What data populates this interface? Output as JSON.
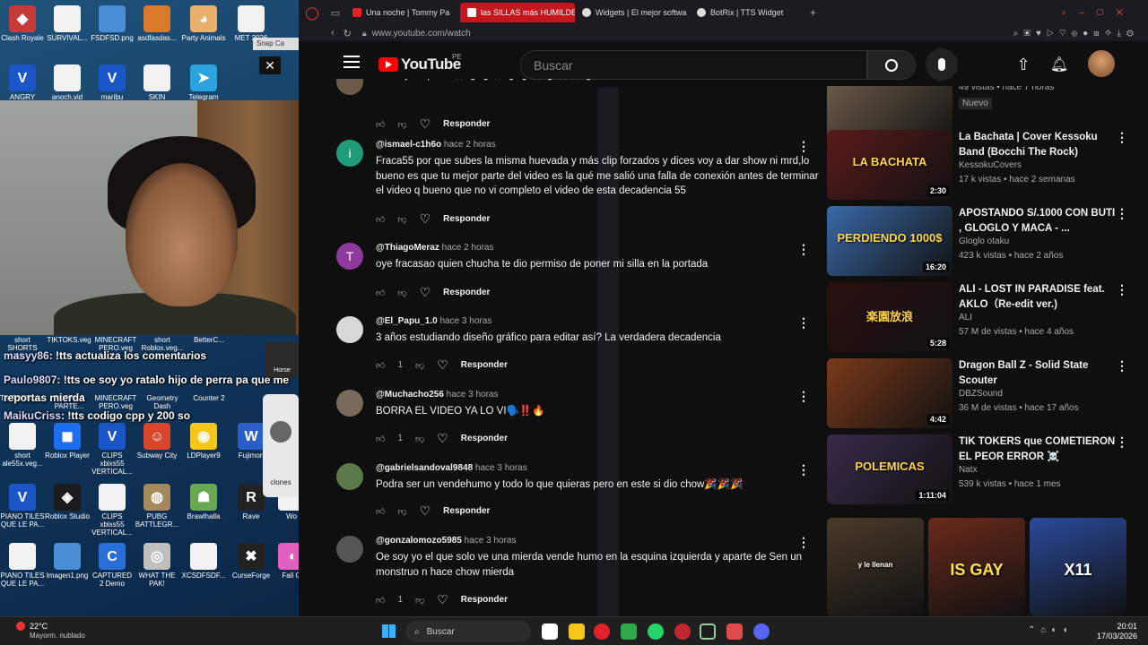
{
  "desktop": {
    "icons": [
      {
        "label": "Clash Royale",
        "color": "#c73a3a",
        "glyph": "◆"
      },
      {
        "label": "SURVIVAL...",
        "color": "#f2f2f2",
        "glyph": ""
      },
      {
        "label": "FSDFSD.png",
        "color": "#4a8fd6",
        "glyph": ""
      },
      {
        "label": "asdfasdas...",
        "color": "#d97a2a",
        "glyph": ""
      },
      {
        "label": "Party Animals",
        "color": "#e8b06a",
        "glyph": "◕"
      },
      {
        "label": "MET 2026",
        "color": "#f2f2f2",
        "glyph": ""
      },
      {
        "label": "ANGRY",
        "color": "#1a56c8",
        "glyph": "V"
      },
      {
        "label": "anoch.vid",
        "color": "#f2f2f2",
        "glyph": ""
      },
      {
        "label": "maribu",
        "color": "#1a56c8",
        "glyph": "V"
      },
      {
        "label": "SKIN",
        "color": "#f2f2f2",
        "glyph": ""
      },
      {
        "label": "Telegram",
        "color": "#2aa3e0",
        "glyph": "➤"
      },
      {
        "label": "short ale55x.veg...",
        "color": "#f2f2f2",
        "glyph": ""
      },
      {
        "label": "Roblox Player",
        "color": "#1e6ff0",
        "glyph": "◼"
      },
      {
        "label": "CLIPS xbixs55 VERTICAL...",
        "color": "#1a56c8",
        "glyph": "V"
      },
      {
        "label": "Subway City",
        "color": "#d9452a",
        "glyph": "☺"
      },
      {
        "label": "LDPlayer9",
        "color": "#f5c518",
        "glyph": "◉"
      },
      {
        "label": "Fujimori",
        "color": "#2a5fc8",
        "glyph": "W"
      },
      {
        "label": "PIANO TILES QUE LE PA...",
        "color": "#1a56c8",
        "glyph": "V"
      },
      {
        "label": "Roblox Studio",
        "color": "#1b1b1b",
        "glyph": "◈"
      },
      {
        "label": "CLIPS xbixs55 VERTICAL...",
        "color": "#f2f2f2",
        "glyph": ""
      },
      {
        "label": "PUBG BATTLEGR...",
        "color": "#a48a5a",
        "glyph": "◍"
      },
      {
        "label": "Brawlhalla",
        "color": "#6aa84f",
        "glyph": "☗"
      },
      {
        "label": "Rave",
        "color": "#222",
        "glyph": "R"
      },
      {
        "label": "Wo",
        "color": "#f2f2f2",
        "glyph": ""
      },
      {
        "label": "PIANO TILES QUE LE PA...",
        "color": "#f2f2f2",
        "glyph": ""
      },
      {
        "label": "Imagen1.png",
        "color": "#4a8fd6",
        "glyph": ""
      },
      {
        "label": "CAPTURED 2 Demo",
        "color": "#2a6fd6",
        "glyph": "C"
      },
      {
        "label": "WHAT THE PAK!",
        "color": "#bfbfbf",
        "glyph": "◎"
      },
      {
        "label": "XCSDFSDF...",
        "color": "#f2f2f2",
        "glyph": ""
      },
      {
        "label": "CurseForge",
        "color": "#222",
        "glyph": "✖"
      },
      {
        "label": "Fall G",
        "color": "#e060c0",
        "glyph": "◖"
      }
    ],
    "row_labels_mid": [
      "short SHORTS AL...",
      "TIKTOKS.veg",
      "MINECRAFT PERO.veg",
      "short Roblox.veg...",
      "BetterC..."
    ],
    "row2_labels": [
      "TIKTOKS.ve...",
      "POPPY 5 PARTE...",
      "MINECRAFT PERO.veg",
      "Geometry Dash",
      "Counter 2"
    ],
    "snap_label": "Snap Ca",
    "clones_label": "clones",
    "horse_label": "Horse",
    "chat": [
      {
        "user": "masyy86",
        "msg": ": !tts actualiza los comentarios"
      },
      {
        "user": "Paulo9807",
        "msg": ": !tts oe soy yo ratalo hijo de perra pa que me reportas mierda"
      },
      {
        "user": "MaikuCriss",
        "msg": ": !tts codigo cpp y 200 so"
      }
    ],
    "webcam_close": "✕"
  },
  "browser": {
    "tabs": [
      {
        "title": "Una noche | Tommy Pa",
        "active": false,
        "color": "#e22"
      },
      {
        "title": "las SILLAS más HUMILDE",
        "active": true,
        "color": "#fff"
      },
      {
        "title": "Widgets | El mejor softwa",
        "active": false,
        "color": "#ddd"
      },
      {
        "title": "BotRix | TTS Widget",
        "active": false,
        "color": "#ddd"
      }
    ],
    "url": "www.youtube.com/watch"
  },
  "youtube": {
    "logo": "YouTube",
    "region": "PE",
    "search_placeholder": "Buscar",
    "comments": [
      {
        "user": "",
        "time": "",
        "avatar_letter": "",
        "avatar_color": "#6b5a48",
        "text": "Mano ya reporte 🦟🕯️🕯️🦟🕯️🕯️🦟🕯️🦟🦟🕯️",
        "likes": "",
        "reply": "Responder"
      },
      {
        "user": "@ismael-c1h6o",
        "time": "hace 2 horas",
        "avatar_letter": "i",
        "avatar_color": "#1f9b7a",
        "text": "Fraca55 por que subes la misma huevada y más clip forzados y dices voy a dar show ni mrd,lo bueno es que tu mejor parte del video es la qué me salió una falla de conexión antes de terminar el video q bueno que no vi completo el video de esta decadencia 55",
        "likes": "",
        "reply": "Responder"
      },
      {
        "user": "@ThiagoMeraz",
        "time": "hace 2 horas",
        "avatar_letter": "T",
        "avatar_color": "#8e3a9e",
        "text": "oye fracasao quien chucha te dio permiso de poner mi silla en la portada",
        "likes": "",
        "reply": "Responder"
      },
      {
        "user": "@El_Papu_1.0",
        "time": "hace 3 horas",
        "avatar_letter": "",
        "avatar_color": "#d8d8d8",
        "text": "3 años estudiando diseño gráfico para editar así? La verdadera decadencia",
        "likes": "1",
        "reply": "Responder"
      },
      {
        "user": "@Muchacho256",
        "time": "hace 3 horas",
        "avatar_letter": "",
        "avatar_color": "#7a6a5a",
        "text": "BORRA EL VIDEO YA LO VI🗣️‼️🔥",
        "likes": "1",
        "reply": "Responder"
      },
      {
        "user": "@gabrielsandoval9848",
        "time": "hace 3 horas",
        "avatar_letter": "",
        "avatar_color": "#5a7a4a",
        "text": "Podra ser un vendehumo y todo lo que quieras pero en este si dio chow🎉🎉🎉",
        "likes": "",
        "reply": "Responder"
      },
      {
        "user": "@gonzalomozo5985",
        "time": "hace 3 horas",
        "avatar_letter": "",
        "avatar_color": "#555",
        "text": "Oe soy yo el que solo ve una mierda vende humo en la esquina izquierda y aparte de Sen un monstruo n hace chow mierda",
        "likes": "1",
        "reply": "Responder"
      }
    ],
    "videos": [
      {
        "title": "",
        "channel": "",
        "meta": "49 vistas • hace 7 horas",
        "badge": "Nuevo",
        "duration": "3:28",
        "thumb": "#6a5a4a"
      },
      {
        "title": "La Bachata | Cover Kessoku Band (Bocchi The Rock)",
        "channel": "KessokuCovers",
        "meta": "17 k vistas • hace 2 semanas",
        "duration": "2:30",
        "thumb": "#5a1a1a",
        "thumb_text": "LA BACHATA"
      },
      {
        "title": "APOSTANDO S/.1000 CON BUTI , GLOGLO Y MACA - ...",
        "channel": "Gloglo otaku",
        "meta": "423 k vistas • hace 2 años",
        "duration": "16:20",
        "thumb": "#3a6aa8",
        "thumb_text": "PERDIENDO 1000$"
      },
      {
        "title": "ALI - LOST IN PARADISE feat. AKLO（Re-edit ver.)",
        "channel": "ALI",
        "meta": "57 M de vistas • hace 4 años",
        "duration": "5:28",
        "thumb": "#2a1010",
        "thumb_text": "楽園放浪"
      },
      {
        "title": "Dragon Ball Z - Solid State Scouter",
        "channel": "DBZSound",
        "meta": "36 M de vistas • hace 17 años",
        "duration": "4:42",
        "thumb": "#7a3a1a"
      },
      {
        "title": "TIK TOKERS que COMETIERON EL PEOR ERROR ☠️",
        "channel": "Natx",
        "meta": "539 k vistas • hace 1 mes",
        "duration": "1:11:04",
        "thumb": "#3a2a4a",
        "thumb_text": "POLEMICAS"
      }
    ],
    "shorts": [
      {
        "caption": "y le llenan",
        "color": "#4a3a2a"
      },
      {
        "caption": "IS GAY",
        "color": "#6a2a1a"
      },
      {
        "caption": "X11",
        "color": "#2a4a9a"
      }
    ]
  },
  "taskbar": {
    "weather_temp": "22°C",
    "weather_desc": "Mayorm. nublado",
    "search": "Buscar",
    "time": "20:01",
    "date": "17/03/2026"
  }
}
